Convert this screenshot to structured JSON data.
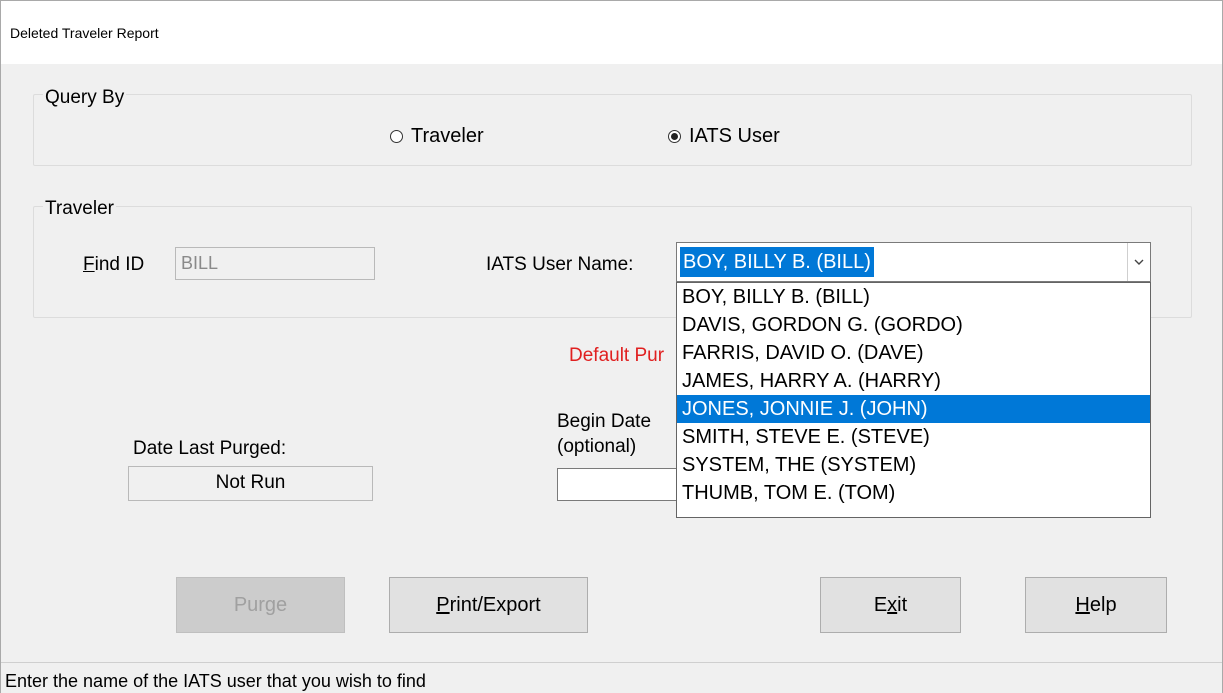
{
  "window": {
    "title": "Deleted Traveler Report"
  },
  "query_by": {
    "label": "Query By",
    "options": [
      {
        "label": "Traveler",
        "checked": false
      },
      {
        "label": "IATS User",
        "checked": true
      }
    ]
  },
  "traveler": {
    "label": "Traveler",
    "find_id_label_first": "F",
    "find_id_label_rest": "ind ID",
    "find_id_value": "BILL",
    "user_name_label": "IATS User Name:",
    "user_name_value": "BOY, BILLY B. (BILL)",
    "user_options": [
      "BOY, BILLY B. (BILL)",
      "DAVIS, GORDON G. (GORDO)",
      "FARRIS, DAVID O. (DAVE)",
      "JAMES, HARRY A. (HARRY)",
      "JONES, JONNIE J. (JOHN)",
      "SMITH, STEVE E. (STEVE)",
      "SYSTEM, THE (SYSTEM)",
      "THUMB, TOM E. (TOM)"
    ],
    "highlighted_option": "JONES, JONNIE J. (JOHN)"
  },
  "purge": {
    "default_label_partial": "Default Pur",
    "date_last_purged_label": "Date Last Purged:",
    "date_last_purged_value": "Not Run",
    "begin_date_label_partial": "Begin Date",
    "begin_date_optional": "(optional)",
    "begin_date_value": ""
  },
  "buttons": {
    "purge": "Purge",
    "print_first": "P",
    "print_rest": "rint/Export",
    "exit_pre": "E",
    "exit_u": "x",
    "exit_post": "it",
    "help_first": "H",
    "help_rest": "elp"
  },
  "status": {
    "text": "Enter the name of the IATS user that you wish to find"
  },
  "colors": {
    "selection": "#0078d7",
    "default_purge_text": "#e02020"
  },
  "icons": {
    "dropdown": "chevron-down-icon"
  }
}
